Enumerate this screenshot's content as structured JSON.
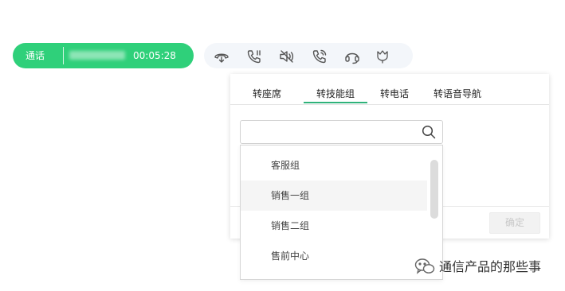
{
  "call": {
    "status": "通话",
    "number": "",
    "timer": "00:05:28"
  },
  "toolbar": {
    "icons": [
      "hold-call-icon",
      "hangup-call-icon",
      "mute-icon",
      "transfer-call-icon",
      "headset-icon",
      "tulip-icon"
    ]
  },
  "transfer": {
    "tabs": [
      "转座席",
      "转技能组",
      "转电话",
      "转语音导航"
    ],
    "active_tab": "转技能组",
    "search_placeholder": "",
    "options": [
      "客服组",
      "销售一组",
      "销售二组",
      "售前中心"
    ],
    "hovered_option": "销售一组",
    "confirm_label": "确定"
  },
  "watermark": {
    "text": "通信产品的那些事"
  },
  "colors": {
    "accent": "#2fd07a",
    "tab_underline": "#2fb27a",
    "toolbar_bg": "#f3f6fa"
  }
}
